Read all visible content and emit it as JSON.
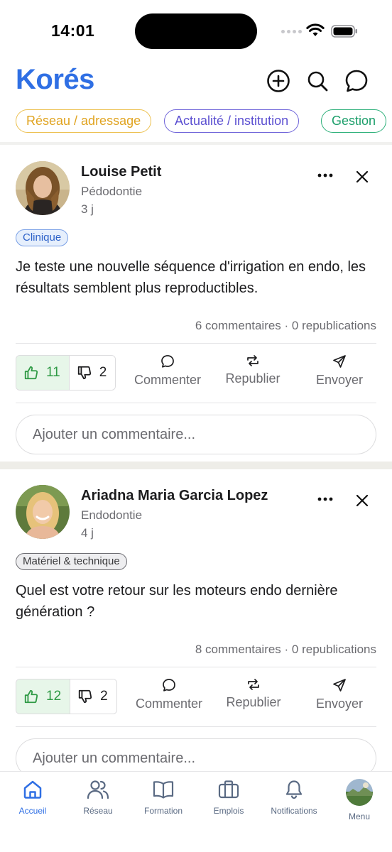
{
  "status_bar": {
    "time": "14:01"
  },
  "header": {
    "logo": "Korés",
    "icons": [
      "plus-circle-icon",
      "search-icon",
      "chat-bubble-icon"
    ]
  },
  "chips": [
    {
      "label": "Réseau / adressage",
      "color": "#e0a31f"
    },
    {
      "label": "Actualité / institution",
      "color": "#5b4fd1"
    },
    {
      "label": "Gestion",
      "color": "#1b9e6a"
    }
  ],
  "posts": [
    {
      "author": "Louise Petit",
      "specialty": "Pédodontie",
      "time": "3 j",
      "tag": "Clinique",
      "text": "Je teste une nouvelle séquence d'irrigation en endo, les résultats semblent plus reproductibles.",
      "stats": "6 commentaires · 0 republications",
      "likes": "11",
      "dislikes": "2",
      "actions": {
        "comment": "Commenter",
        "repost": "Republier",
        "send": "Envoyer"
      },
      "comment_placeholder": "Ajouter un commentaire..."
    },
    {
      "author": "Ariadna Maria Garcia Lopez",
      "specialty": "Endodontie",
      "time": "4 j",
      "tag": "Matériel & technique",
      "text": "Quel est votre retour sur les moteurs endo dernière génération ?",
      "stats": "8 commentaires · 0 republications",
      "likes": "12",
      "dislikes": "2",
      "actions": {
        "comment": "Commenter",
        "repost": "Republier",
        "send": "Envoyer"
      },
      "comment_placeholder": "Ajouter un commentaire..."
    }
  ],
  "bottom_nav": [
    {
      "label": "Accueil",
      "icon": "home-icon",
      "active": true
    },
    {
      "label": "Réseau",
      "icon": "people-icon",
      "active": false
    },
    {
      "label": "Formation",
      "icon": "book-icon",
      "active": false
    },
    {
      "label": "Emplois",
      "icon": "briefcase-icon",
      "active": false
    },
    {
      "label": "Notifications",
      "icon": "bell-icon",
      "active": false
    },
    {
      "label": "Menu",
      "icon": "profile-avatar",
      "active": false
    }
  ],
  "colors": {
    "brand": "#2f6fe4",
    "like_green": "#2f9a45",
    "muted": "#6b6b70"
  }
}
